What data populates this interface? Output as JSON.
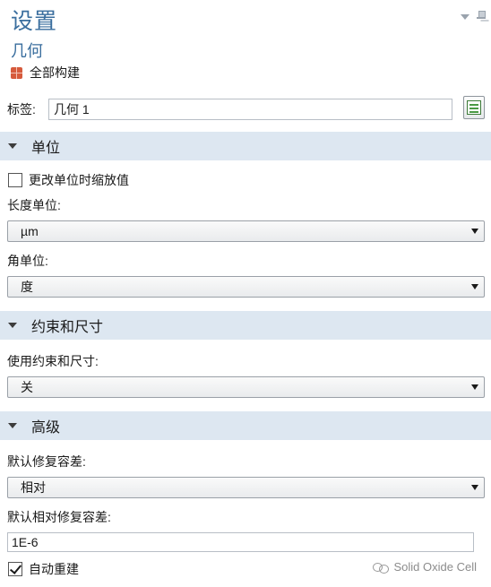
{
  "panel": {
    "title": "设置",
    "subtitle": "几何"
  },
  "build_all": {
    "label": "全部构建",
    "icon": "build-all-icon"
  },
  "label_field": {
    "label": "标签:",
    "value": "几何 1"
  },
  "sections": {
    "units": {
      "header": "单位",
      "scale_checkbox": {
        "label": "更改单位时缩放值",
        "checked": false
      },
      "length_unit": {
        "label": "长度单位:",
        "value": "µm"
      },
      "angle_unit": {
        "label": "角单位:",
        "value": "度"
      }
    },
    "constraints": {
      "header": "约束和尺寸",
      "use_constraints": {
        "label": "使用约束和尺寸:",
        "value": "关"
      }
    },
    "advanced": {
      "header": "高级",
      "repair_tolerance": {
        "label": "默认修复容差:",
        "value": "相对"
      },
      "relative_repair_tolerance": {
        "label": "默认相对修复容差:",
        "value": "1E-6"
      },
      "auto_rebuild": {
        "label": "自动重建",
        "checked": true
      }
    }
  },
  "watermark": {
    "text": "Solid Oxide Cell"
  },
  "colors": {
    "title": "#3a6e9e",
    "section_bg": "#dde7f1",
    "build_icon": "#d65a3c",
    "label_icon": "#4a9a44"
  }
}
